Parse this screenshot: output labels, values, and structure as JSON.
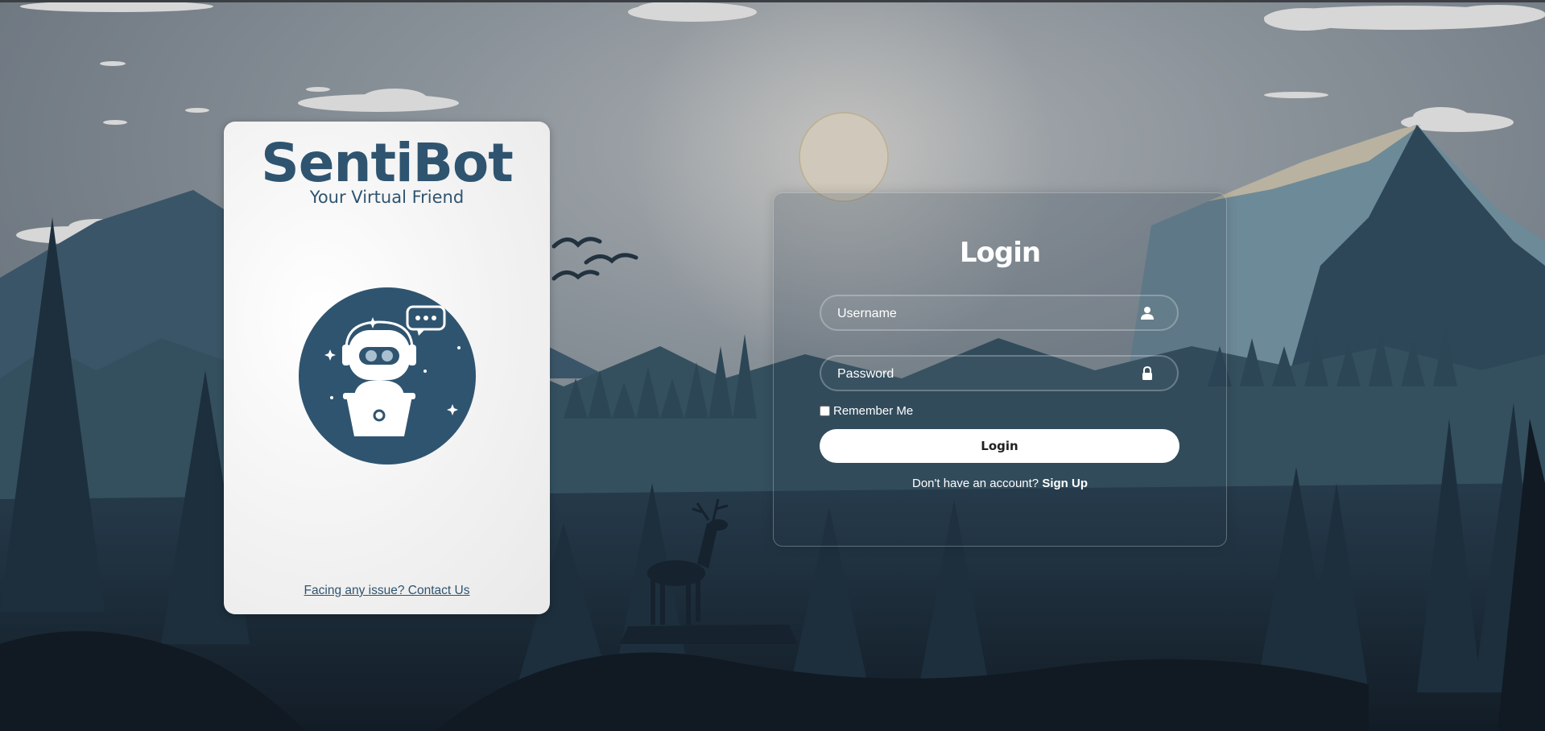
{
  "brand": {
    "name": "SentiBot",
    "tagline": "Your Virtual Friend",
    "contact_link": "Facing any issue? Contact Us",
    "color": "#2f5470"
  },
  "login": {
    "heading": "Login",
    "username_placeholder": "Username",
    "password_placeholder": "Password",
    "username_icon": "user-icon",
    "password_icon": "lock-icon",
    "remember_label": "Remember Me",
    "remember_checked": false,
    "button_label": "Login",
    "signup_prompt": "Don't have an account?",
    "signup_link": "Sign Up"
  },
  "background": {
    "theme": "misty mountain forest at dusk with moon, birds and deer",
    "sky_color": "#737e88",
    "forest_color": "#1f3342"
  }
}
